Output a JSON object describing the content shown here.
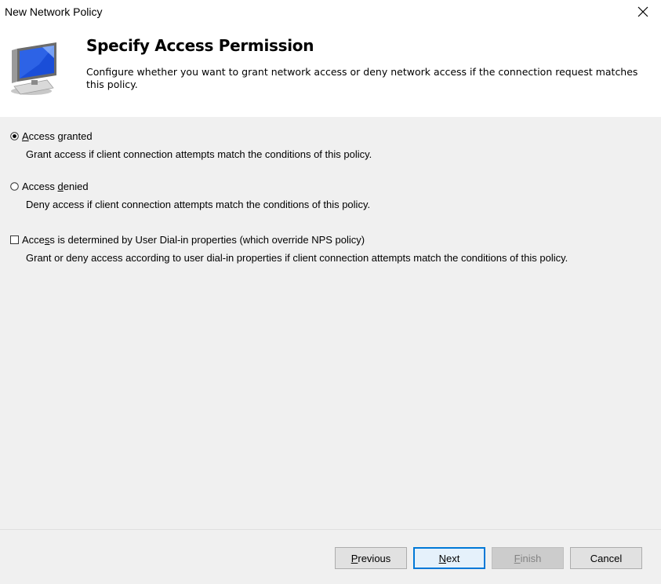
{
  "window": {
    "title": "New Network Policy",
    "close_glyph": "✕"
  },
  "header": {
    "heading": "Specify Access Permission",
    "description": "Configure whether you want to grant network access or deny network access if the connection request matches this policy.",
    "icon": "computer-monitor-icon"
  },
  "options": [
    {
      "type": "radio",
      "checked": true,
      "label_pre": "",
      "label_ul": "A",
      "label_post": "ccess granted",
      "help": "Grant access if client connection attempts match the conditions of this policy."
    },
    {
      "type": "radio",
      "checked": false,
      "label_pre": "Access ",
      "label_ul": "d",
      "label_post": "enied",
      "help": "Deny access if client connection attempts match the conditions of this policy."
    },
    {
      "type": "checkbox",
      "checked": false,
      "label_pre": "Acce",
      "label_ul": "s",
      "label_post": "s is determined by User Dial-in properties (which override NPS policy)",
      "help": "Grant or deny access according to user dial-in properties if client connection attempts match the conditions of this policy."
    }
  ],
  "buttons": {
    "previous": {
      "pre": "",
      "ul": "P",
      "post": "revious"
    },
    "next": {
      "pre": "",
      "ul": "N",
      "post": "ext"
    },
    "finish": {
      "pre": "",
      "ul": "F",
      "post": "inish"
    },
    "cancel": {
      "label": "Cancel"
    }
  },
  "colors": {
    "content_bg": "#f0f0f0",
    "default_button_border": "#0078d7"
  }
}
